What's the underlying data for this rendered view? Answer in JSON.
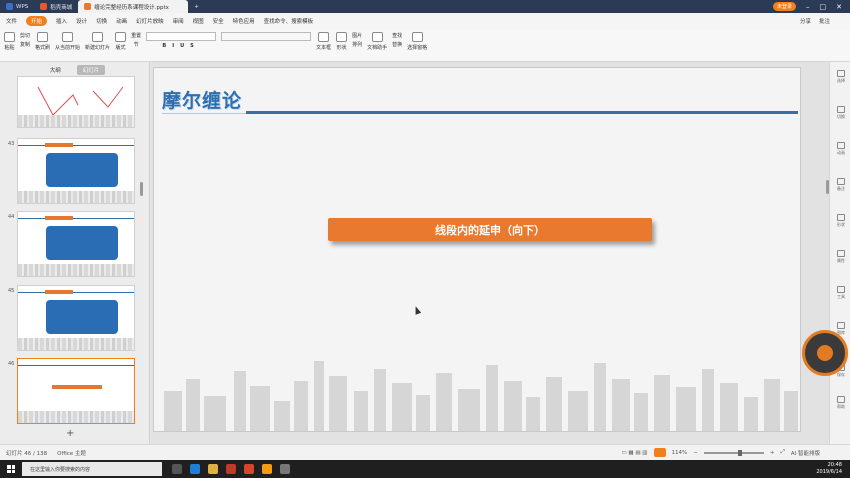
{
  "tabs": [
    {
      "label": "WPS"
    },
    {
      "label": "稻壳商城"
    },
    {
      "label": "缠论完整经历系课程设计.pptx"
    }
  ],
  "window": {
    "login_label": "未登录"
  },
  "menu": {
    "file": "文件",
    "start": "开始",
    "items": [
      "插入",
      "设计",
      "切换",
      "动画",
      "幻灯片放映",
      "审阅",
      "视图",
      "安全",
      "特色应用"
    ],
    "search": "查找命令、搜索模板",
    "share": "分享",
    "comment": "批注"
  },
  "ribbon": {
    "paste": "粘贴",
    "cut": "剪切",
    "copy": "复制",
    "format": "格式刷",
    "from_start": "从当前开始",
    "new_slide": "新建幻灯片",
    "layout": "版式",
    "reset": "重置",
    "section": "节",
    "textbox": "文本框",
    "shape": "形状",
    "arrange": "排列",
    "picture": "图片",
    "text_helper": "文档助手",
    "replace": "替换",
    "find": "查找",
    "select_pane": "选择窗格"
  },
  "panel": {
    "outline": "大纲",
    "slides": "幻灯片",
    "thumbs": [
      {
        "num": "43"
      },
      {
        "num": "44"
      },
      {
        "num": "45"
      },
      {
        "num": "46"
      }
    ],
    "add": "+"
  },
  "slide": {
    "title": "摩尔缠论",
    "banner": "线段内的延申（向下）"
  },
  "sidebar": {
    "items": [
      "选择",
      "切换",
      "动画",
      "备注",
      "形状",
      "属性",
      "工具",
      "图库",
      "保存",
      "帮助"
    ]
  },
  "status": {
    "slide_count": "幻灯片 46 / 138",
    "theme": "Office 主题",
    "zoom": "114%",
    "ai": "AI·智能排版"
  },
  "taskbar": {
    "search": "在这里输入你要搜索的内容",
    "time": "20:48",
    "date": "2019/6/14"
  }
}
